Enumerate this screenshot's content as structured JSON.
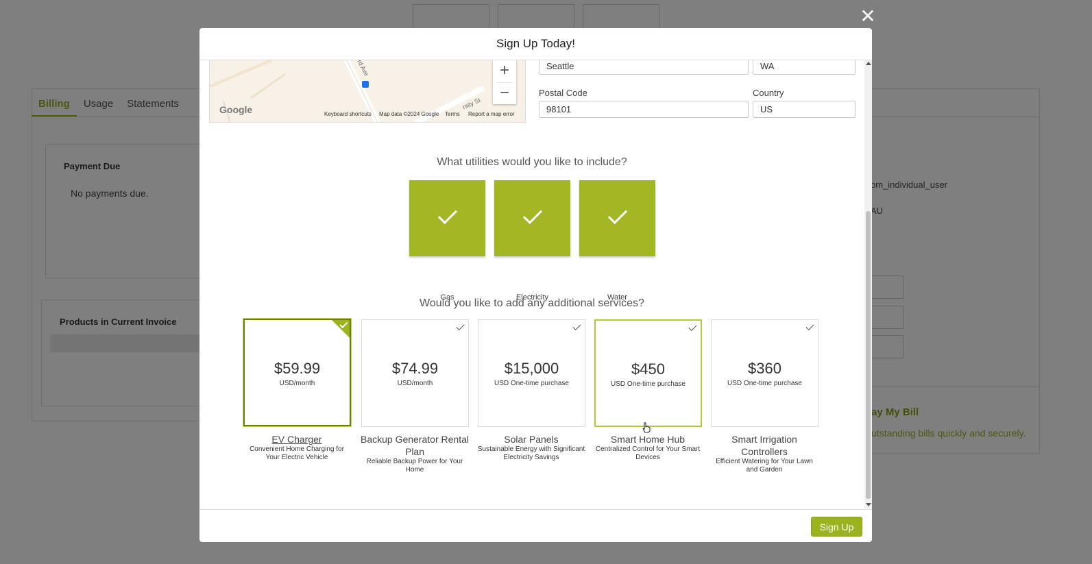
{
  "background": {
    "tabs": [
      {
        "label": "Billing"
      },
      {
        "label": "Usage"
      },
      {
        "label": "Statements"
      }
    ],
    "payment_due": {
      "title": "Payment Due",
      "message": "No payments due."
    },
    "products": {
      "title": "Products in Current Invoice"
    },
    "right_text_1": "om_individual_user",
    "right_text_2": "AU",
    "pay_bill": {
      "title": "ay My Bill",
      "subtitle": "utstanding bills quickly and securely."
    }
  },
  "modal": {
    "title": "Sign Up Today!",
    "close_label": "✕",
    "map": {
      "zoom_in": "+",
      "zoom_out": "−",
      "logo": "Google",
      "attribution": [
        "Keyboard shortcuts",
        "Map data ©2024 Google",
        "Terms",
        "Report a map error"
      ],
      "street_1": "rd Ave",
      "street_2": "rsity St"
    },
    "address": {
      "city_value": "Seattle",
      "state_value": "WA",
      "postal_label": "Postal Code",
      "postal_value": "98101",
      "country_label": "Country",
      "country_value": "US"
    },
    "utilities": {
      "question": "What utilities would you like to include?",
      "items": [
        {
          "label": "Gas",
          "selected": true
        },
        {
          "label": "Electricity",
          "selected": true
        },
        {
          "label": "Water",
          "selected": true
        }
      ]
    },
    "services": {
      "question": "Would you like to add any additional services?",
      "items": [
        {
          "price": "$59.99",
          "unit": "USD/month",
          "name": "EV Charger",
          "description": "Convenient Home Charging for Your Electric Vehicle",
          "selected": true
        },
        {
          "price": "$74.99",
          "unit": "USD/month",
          "name": "Backup Generator Rental Plan",
          "description": "Reliable Backup Power for Your Home",
          "selected": false
        },
        {
          "price": "$15,000",
          "unit": "USD One-time purchase",
          "name": "Solar Panels",
          "description": "Sustainable Energy with Significant Electricity Savings",
          "selected": false
        },
        {
          "price": "$450",
          "unit": "USD One-time purchase",
          "name": "Smart Home Hub",
          "description": "Centralized Control for Your Smart Devices",
          "selected": false
        },
        {
          "price": "$360",
          "unit": "USD One-time purchase",
          "name": "Smart Irrigation Controllers",
          "description": "Efficient Watering for Your Lawn and Garden",
          "selected": false
        }
      ]
    },
    "submit_label": "Sign Up"
  },
  "colors": {
    "accent": "#9bb31f",
    "tile": "#a3b623",
    "overlay": "rgba(0,0,0,0.5)"
  }
}
